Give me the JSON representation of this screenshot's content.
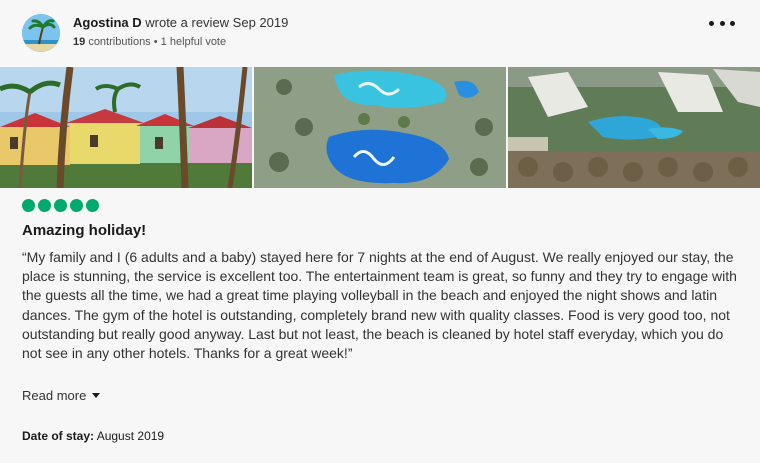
{
  "review": {
    "reviewer_name": "Agostina D",
    "action_text": "wrote a review Sep 2019",
    "contributions": "19",
    "contributions_label": "contributions",
    "separator": "•",
    "helpful_votes": "1 helpful vote",
    "rating": 5,
    "rating_max": 5,
    "title": "Amazing holiday!",
    "body": "“My family and I (6 adults and a baby) stayed here for 7 nights at the end of August. We really enjoyed our stay, the place is stunning, the service is excellent too. The entertainment team is great, so funny and they try to engage with the guests all the time, we had a great time playing volleyball in the beach and enjoyed the night shows and latin dances. The gym of the hotel is outstanding, completely brand new with quality classes. Food is very good too, not outstanding but really good anyway. Last but not least, the beach is cleaned by hotel staff everyday, which you do not see in any other hotels. Thanks for a great week!”",
    "read_more": "Read more",
    "date_of_stay_label": "Date of stay:",
    "date_of_stay": "August 2019"
  },
  "photos": [
    {
      "subject": "colorful-bungalows-with-palm-trees"
    },
    {
      "subject": "aerial-view-of-pools"
    },
    {
      "subject": "aerial-view-of-resort"
    }
  ],
  "colors": {
    "rating_bubble": "#00aa6c",
    "background": "#f7f7f7",
    "text": "#1a1a1a"
  },
  "icons": {
    "more_options": "more-horizontal-icon",
    "read_more_caret": "chevron-down-icon"
  }
}
